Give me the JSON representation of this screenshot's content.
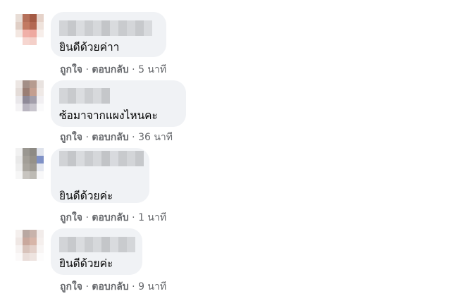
{
  "comments": [
    {
      "text": "ยินดีด้วยค่าา",
      "like_label": "ถูกใจ",
      "separator": "·",
      "reply_label": "ตอบกลับ",
      "time": "5 นาที"
    },
    {
      "text": "ซ้อมาจากแผงไหนคะ",
      "like_label": "ถูกใจ",
      "separator": "·",
      "reply_label": "ตอบกลับ",
      "time": "36 นาที"
    },
    {
      "text": "ยินดีด้วยค่ะ",
      "like_label": "ถูกใจ",
      "separator": "·",
      "reply_label": "ตอบกลับ",
      "time": "1 นาที"
    },
    {
      "text": "ยินดีด้วยค่ะ",
      "like_label": "ถูกใจ",
      "separator": "·",
      "reply_label": "ตอบกลับ",
      "time": "9 นาที"
    }
  ],
  "colors": {
    "bubble": "#f0f2f5",
    "text": "#050505",
    "meta": "#65676b"
  }
}
